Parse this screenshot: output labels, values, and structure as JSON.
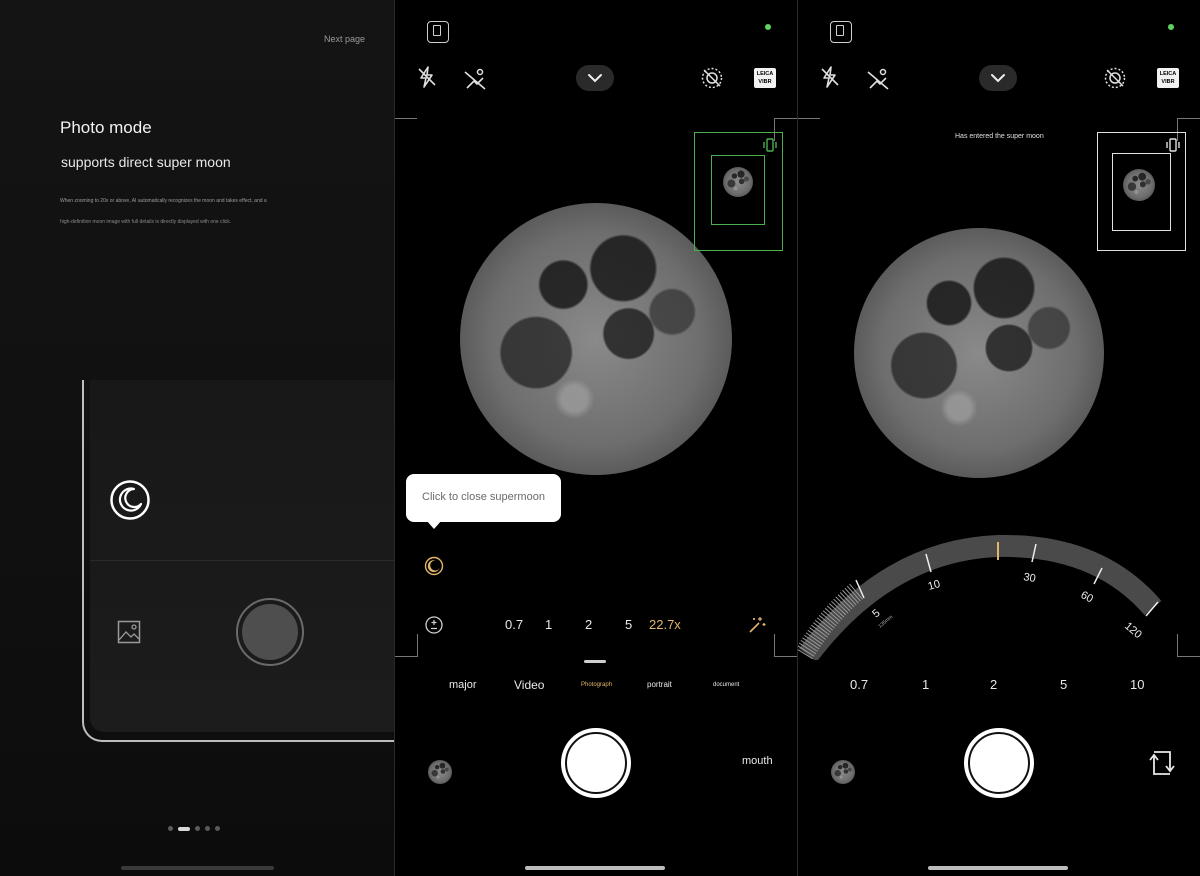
{
  "panel1": {
    "next_page": "Next page",
    "title": "Photo mode",
    "subtitle": "supports direct super moon",
    "description_line1": "When zooming to 20x or above, AI automatically recognizes the moon and takes effect, and a",
    "description_line2": "high-definition moon image with full details is directly displayed with one click.",
    "icons": [
      "moon-icon",
      "gallery-icon"
    ],
    "page_indicator": {
      "total": 5,
      "active": 2
    }
  },
  "panel2": {
    "tooltip": "Click to close supermoon",
    "zoom_levels": [
      "0.7",
      "1",
      "2",
      "5",
      "22.7x"
    ],
    "active_zoom": "22.7x",
    "modes": [
      "major",
      "Video",
      "Photograph",
      "portrait",
      "document"
    ],
    "active_mode": "Photograph",
    "right_label": "mouth",
    "leica_badge": [
      "LEICA",
      "VIBR"
    ],
    "colors": {
      "accent": "#e2b66a",
      "preview_frame": "#4caf50",
      "status_dot": "#5fd35f"
    }
  },
  "panel3": {
    "status_text": "Has entered the super moon",
    "dial_labels": [
      "5",
      "10",
      "30",
      "60",
      "120"
    ],
    "dial_sub_label": "135mm",
    "zoom_levels": [
      "0.7",
      "1",
      "2",
      "5",
      "10"
    ],
    "leica_badge": [
      "LEICA",
      "VIBR"
    ]
  }
}
